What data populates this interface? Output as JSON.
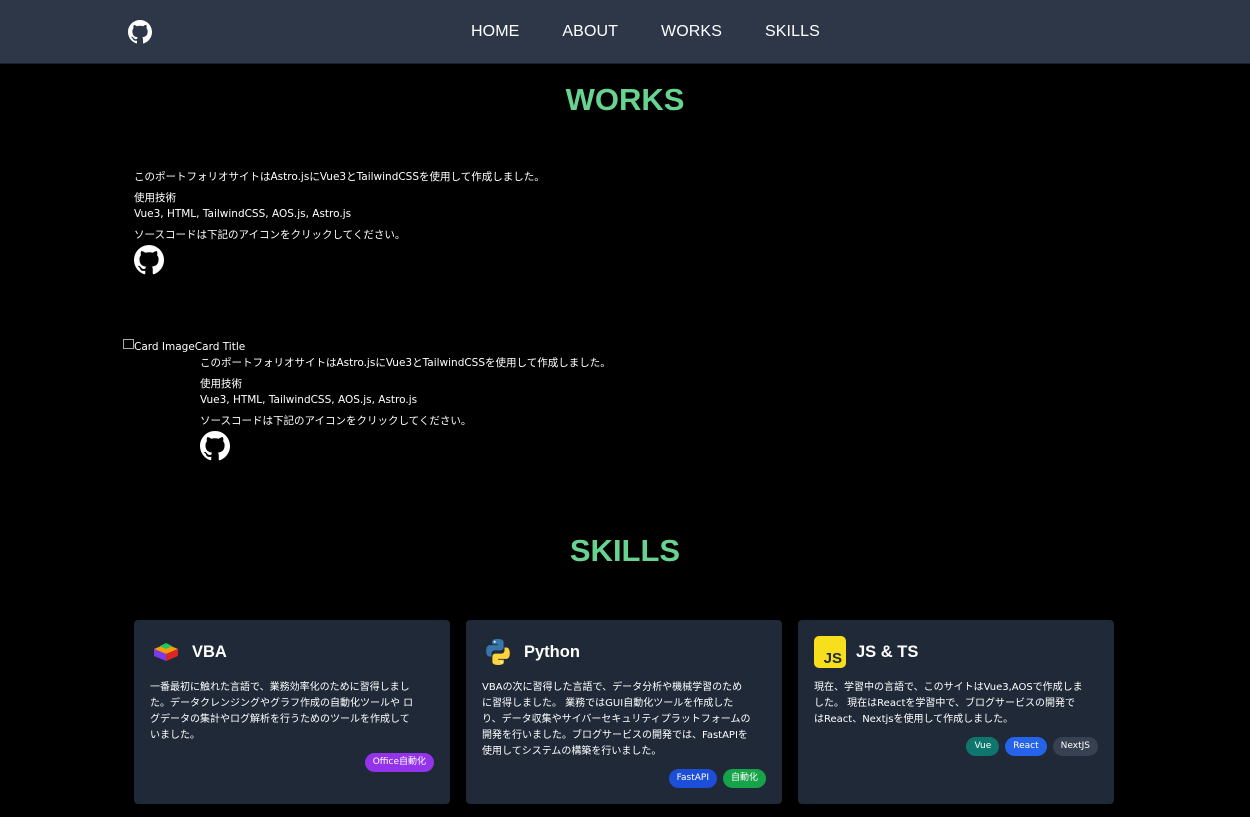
{
  "nav": {
    "links": [
      "HOME",
      "ABOUT",
      "WORKS",
      "SKILLS"
    ]
  },
  "works": {
    "title": "WORKS",
    "items": [
      {
        "description": "このポートフォリオサイトはAstro.jsにVue3とTailwindCSSを使用して作成しました。",
        "tech_label": "使用技術",
        "tech": "Vue3, HTML, TailwindCSS, AOS.js, Astro.js",
        "source_note": "ソースコードは下記のアイコンをクリックしてください。"
      }
    ],
    "card": {
      "image_alt": "Card Image",
      "title": "Card Title",
      "description": "このポートフォリオサイトはAstro.jsにVue3とTailwindCSSを使用して作成しました。",
      "tech_label": "使用技術",
      "tech": "Vue3, HTML, TailwindCSS, AOS.js, Astro.js",
      "source_note": "ソースコードは下記のアイコンをクリックしてください。"
    }
  },
  "skills": {
    "title": "SKILLS",
    "cards": [
      {
        "name": "VBA",
        "icon": "vba-icon",
        "lines": [
          "一番最初に触れた言語で、業務効率化のために習得しまし",
          "た。データクレンジングやグラフ作成の自動化ツールや ロ",
          "グデータの集計やログ解析を行うためのツールを作成して",
          "いました。"
        ],
        "badges": [
          {
            "label": "Office自動化",
            "color": "#9333ea"
          }
        ]
      },
      {
        "name": "Python",
        "icon": "python-icon",
        "lines": [
          "VBAの次に習得した言語で、データ分析や機械学習のため",
          "に習得しました。 業務ではGUI自動化ツールを作成した",
          "り、データ収集やサイバーセキュリティプラットフォームの",
          "開発を行いました。ブログサービスの開発では、FastAPIを",
          "使用してシステムの構築を行いました。"
        ],
        "badges": [
          {
            "label": "FastAPI",
            "color": "#1d4ed8"
          },
          {
            "label": "自動化",
            "color": "#16a34a"
          }
        ]
      },
      {
        "name": "JS & TS",
        "icon": "javascript-icon",
        "lines": [
          "現在、学習中の言語で、このサイトはVue3,AOSで作成しま",
          "した。 現在はReactを学習中で、ブログサービスの開発で",
          "はReact、Nextjsを使用して作成しました。"
        ],
        "badges": [
          {
            "label": "Vue",
            "color": "#0f766e"
          },
          {
            "label": "React",
            "color": "#2563eb"
          },
          {
            "label": "NextJS",
            "color": "#374151"
          }
        ]
      }
    ]
  },
  "colors": {
    "navbar": "#2d3748",
    "accent": "#68d391",
    "card": "#1f2937",
    "background": "#000000"
  }
}
